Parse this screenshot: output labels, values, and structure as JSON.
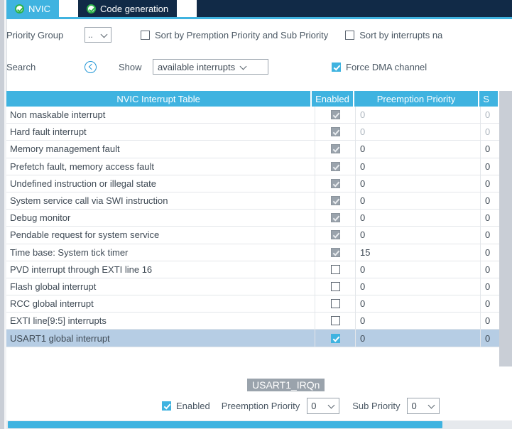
{
  "tabs": [
    {
      "label": "NVIC",
      "icon": "check-circle-icon",
      "active": true
    },
    {
      "label": "Code generation",
      "icon": "check-circle-icon",
      "active": false
    }
  ],
  "options": {
    "priority_group_label": "Priority Group",
    "priority_group_value": "..",
    "sort_preemption_label": "Sort by Premption Priority and Sub Priority",
    "sort_preemption_checked": false,
    "sort_name_label": "Sort by interrupts na",
    "sort_name_checked": false,
    "search_label": "Search",
    "search_icon": "back-circle-icon",
    "show_label": "Show",
    "show_value": "available interrupts",
    "force_dma_label": "Force DMA channel",
    "force_dma_checked": true
  },
  "table": {
    "columns": [
      "NVIC Interrupt Table",
      "Enabled",
      "Preemption Priority",
      "S"
    ],
    "rows": [
      {
        "name": "Non maskable interrupt",
        "enabled": true,
        "enabled_state": "disabled",
        "preemption": "0",
        "sub": "0",
        "dim": true,
        "selected": false
      },
      {
        "name": "Hard fault interrupt",
        "enabled": true,
        "enabled_state": "disabled",
        "preemption": "0",
        "sub": "0",
        "dim": true,
        "selected": false
      },
      {
        "name": "Memory management fault",
        "enabled": true,
        "enabled_state": "disabled",
        "preemption": "0",
        "sub": "0",
        "dim": false,
        "selected": false
      },
      {
        "name": "Prefetch fault, memory access fault",
        "enabled": true,
        "enabled_state": "disabled",
        "preemption": "0",
        "sub": "0",
        "dim": false,
        "selected": false
      },
      {
        "name": "Undefined instruction or illegal state",
        "enabled": true,
        "enabled_state": "disabled",
        "preemption": "0",
        "sub": "0",
        "dim": false,
        "selected": false
      },
      {
        "name": "System service call via SWI instruction",
        "enabled": true,
        "enabled_state": "disabled",
        "preemption": "0",
        "sub": "0",
        "dim": false,
        "selected": false
      },
      {
        "name": "Debug monitor",
        "enabled": true,
        "enabled_state": "disabled",
        "preemption": "0",
        "sub": "0",
        "dim": false,
        "selected": false
      },
      {
        "name": "Pendable request for system service",
        "enabled": true,
        "enabled_state": "disabled",
        "preemption": "0",
        "sub": "0",
        "dim": false,
        "selected": false
      },
      {
        "name": "Time base: System tick timer",
        "enabled": true,
        "enabled_state": "disabled",
        "preemption": "15",
        "sub": "0",
        "dim": false,
        "selected": false
      },
      {
        "name": "PVD interrupt through EXTI line 16",
        "enabled": false,
        "enabled_state": "normal",
        "preemption": "0",
        "sub": "0",
        "dim": false,
        "selected": false
      },
      {
        "name": "Flash global interrupt",
        "enabled": false,
        "enabled_state": "normal",
        "preemption": "0",
        "sub": "0",
        "dim": false,
        "selected": false
      },
      {
        "name": "RCC global interrupt",
        "enabled": false,
        "enabled_state": "normal",
        "preemption": "0",
        "sub": "0",
        "dim": false,
        "selected": false
      },
      {
        "name": "EXTI line[9:5] interrupts",
        "enabled": false,
        "enabled_state": "normal",
        "preemption": "0",
        "sub": "0",
        "dim": false,
        "selected": false
      },
      {
        "name": "USART1 global interrupt",
        "enabled": true,
        "enabled_state": "on",
        "preemption": "0",
        "sub": "0",
        "dim": false,
        "selected": true
      }
    ]
  },
  "detail": {
    "badge": "USART1_IRQn",
    "enabled_label": "Enabled",
    "enabled_checked": true,
    "preemption_label": "Preemption Priority",
    "preemption_value": "0",
    "sub_label": "Sub Priority",
    "sub_value": "0"
  },
  "colors": {
    "accent": "#3fb3e0",
    "tab_inactive": "#112a47",
    "selection": "#b6cde4",
    "badge_bg": "#9aa3ac",
    "check_green": "#2db34a"
  }
}
